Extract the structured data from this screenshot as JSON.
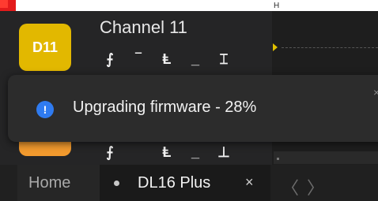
{
  "channel": {
    "badge": "D11",
    "title": "Channel 11",
    "tools": [
      {
        "name": "rising-edge-icon",
        "glyph": "⨍"
      },
      {
        "name": "high-level-icon",
        "glyph": "‾"
      },
      {
        "name": "falling-edge-icon",
        "glyph": "Ⱡ"
      },
      {
        "name": "low-level-icon",
        "glyph": "_"
      },
      {
        "name": "either-edge-icon",
        "glyph": "⌶"
      }
    ],
    "tools2": [
      {
        "name": "rising-edge-icon",
        "glyph": "⨍"
      },
      {
        "name": "falling-edge-icon",
        "glyph": "Ⱡ"
      },
      {
        "name": "low-level-icon",
        "glyph": "_"
      },
      {
        "name": "either-edge-icon",
        "glyph": "⊥"
      }
    ]
  },
  "header": {
    "h_label": "H"
  },
  "toast": {
    "icon": "!",
    "message": "Upgrading firmware - 28%",
    "close": "×"
  },
  "tabs": {
    "home": "Home",
    "active": "DL16 Plus",
    "close": "×",
    "prev": "〈",
    "next": "〉"
  },
  "colors": {
    "badge_yellow": "#e2b800",
    "badge_orange": "#f29a2e",
    "info_blue": "#2f7bf0"
  }
}
